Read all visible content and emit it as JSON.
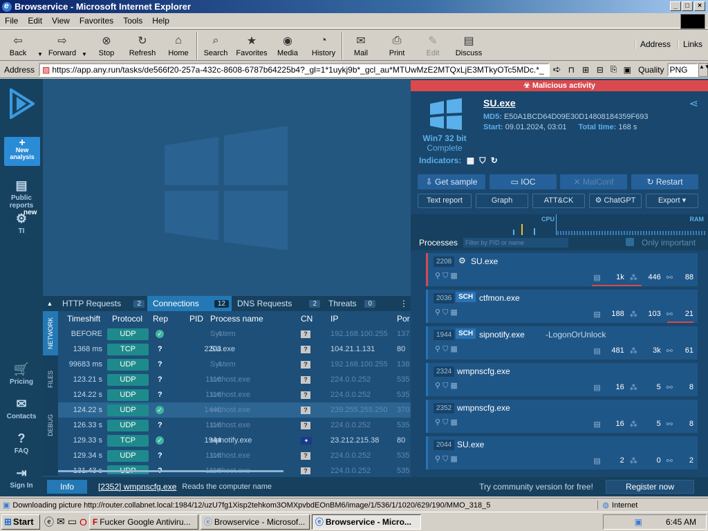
{
  "window": {
    "title": "Browservice - Microsoft Internet Explorer"
  },
  "menu": [
    "File",
    "Edit",
    "View",
    "Favorites",
    "Tools",
    "Help"
  ],
  "toolbar": {
    "back": "Back",
    "forward": "Forward",
    "stop": "Stop",
    "refresh": "Refresh",
    "home": "Home",
    "search": "Search",
    "favorites": "Favorites",
    "media": "Media",
    "history": "History",
    "mail": "Mail",
    "print": "Print",
    "edit": "Edit",
    "discuss": "Discuss",
    "address_label": "Address",
    "links_label": "Links"
  },
  "addressbar": {
    "label": "Address",
    "url": "https://app.any.run/tasks/de566f20-257a-432c-8608-6787b64225b4?_gl=1*1uykj9b*_gcl_au*MTUwMzE2MTQxLjE3MTkyOTc5MDc.*_",
    "quality_label": "Quality",
    "quality_value": "PNG"
  },
  "leftnav": {
    "new_analysis": "New analysis",
    "public_reports": "Public reports",
    "ti_badge": "new",
    "ti": "TI",
    "pricing": "Pricing",
    "contacts": "Contacts",
    "faq": "FAQ",
    "signin": "Sign In"
  },
  "tabs": [
    {
      "label": "HTTP Requests",
      "count": "2"
    },
    {
      "label": "Connections",
      "count": "12"
    },
    {
      "label": "DNS Requests",
      "count": "2"
    },
    {
      "label": "Threats",
      "count": "0"
    }
  ],
  "vtabs": [
    "NETWORK",
    "FILES",
    "DEBUG"
  ],
  "connections": {
    "headers": [
      "Timeshift",
      "Protocol",
      "Rep",
      "PID",
      "Process name",
      "CN",
      "IP",
      "Por"
    ],
    "rows": [
      {
        "time": "BEFORE",
        "proto": "UDP",
        "rep": "ok",
        "pid": "4",
        "proc": "System",
        "ip": "192.168.100.255",
        "port": "137"
      },
      {
        "time": "1368 ms",
        "proto": "TCP",
        "rep": "?",
        "pid": "2208",
        "proc": "SU.exe",
        "ip": "104.21.1.131",
        "port": "80"
      },
      {
        "time": "99683 ms",
        "proto": "UDP",
        "rep": "?",
        "pid": "4",
        "proc": "System",
        "ip": "192.168.100.255",
        "port": "138"
      },
      {
        "time": "123.21 s",
        "proto": "UDP",
        "rep": "?",
        "pid": "1116",
        "proc": "svchost.exe",
        "ip": "224.0.0.252",
        "port": "535"
      },
      {
        "time": "124.22 s",
        "proto": "UDP",
        "rep": "?",
        "pid": "1116",
        "proc": "svchost.exe",
        "ip": "224.0.0.252",
        "port": "535"
      },
      {
        "time": "124.22 s",
        "proto": "UDP",
        "rep": "ok",
        "pid": "1440",
        "proc": "svchost.exe",
        "ip": "239.255.255.250",
        "port": "370"
      },
      {
        "time": "126.33 s",
        "proto": "UDP",
        "rep": "?",
        "pid": "1116",
        "proc": "svchost.exe",
        "ip": "224.0.0.252",
        "port": "535"
      },
      {
        "time": "129.33 s",
        "proto": "TCP",
        "rep": "ok",
        "pid": "1944",
        "proc": "sipnotify.exe",
        "ip": "23.212.215.38",
        "port": "80"
      },
      {
        "time": "129.34 s",
        "proto": "UDP",
        "rep": "?",
        "pid": "1116",
        "proc": "svchost.exe",
        "ip": "224.0.0.252",
        "port": "535"
      },
      {
        "time": "131.43 s",
        "proto": "UDP",
        "rep": "?",
        "pid": "1116",
        "proc": "svchost.exe",
        "ip": "224.0.0.252",
        "port": "535"
      }
    ]
  },
  "infobar": {
    "button": "Info",
    "proc": "[2352] wmpnscfg.exe",
    "text": "Reads the computer name",
    "community": "Try community version for free!",
    "register": "Register now"
  },
  "report": {
    "malicious": "Malicious activity",
    "filename": "SU.exe",
    "md5_label": "MD5:",
    "md5": "E50A1BCD64D09E30D14808184359F693",
    "start_label": "Start:",
    "start": "09.01.2024, 03:01",
    "total_label": "Total time:",
    "total": "168 s",
    "os": "Win7 32 bit",
    "status": "Complete",
    "indicators": "Indicators:",
    "get_sample": "Get sample",
    "ioc": "IOC",
    "malconf": "MalConf",
    "restart": "Restart",
    "text_report": "Text report",
    "graph": "Graph",
    "attck": "ATT&CK",
    "chatgpt": "ChatGPT",
    "export": "Export",
    "cpu": "CPU",
    "ram": "RAM",
    "processes": "Processes",
    "filter_placeholder": "Filter by PID or name",
    "only_important": "Only important"
  },
  "processes": [
    {
      "pid": "2208",
      "name": "SU.exe",
      "sch": "",
      "args": "",
      "s1": "1k",
      "s2": "446",
      "s3": "88",
      "bad": true
    },
    {
      "pid": "2036",
      "name": "ctfmon.exe",
      "sch": "SCH",
      "args": "",
      "s1": "188",
      "s2": "103",
      "s3": "21",
      "bad": false
    },
    {
      "pid": "1944",
      "name": "sipnotify.exe",
      "sch": "SCH",
      "args": "-LogonOrUnlock",
      "s1": "481",
      "s2": "3k",
      "s3": "61",
      "bad": false
    },
    {
      "pid": "2324",
      "name": "wmpnscfg.exe",
      "sch": "",
      "args": "",
      "s1": "16",
      "s2": "5",
      "s3": "8",
      "bad": false
    },
    {
      "pid": "2352",
      "name": "wmpnscfg.exe",
      "sch": "",
      "args": "",
      "s1": "16",
      "s2": "5",
      "s3": "8",
      "bad": false
    },
    {
      "pid": "2044",
      "name": "SU.exe",
      "sch": "",
      "args": "",
      "s1": "2",
      "s2": "0",
      "s3": "2",
      "bad": false
    }
  ],
  "statusbar": {
    "text": "Downloading picture http://router.collabnet.local:1984/12/uzU7fg1Xisp2tehkom3OMXpvbdEOnBM6/image/1/536/1/1020/629/190/MMO_318_5",
    "zone": "Internet"
  },
  "taskbar": {
    "start": "Start",
    "tasks": [
      "Fucker Google Antiviru...",
      "Browservice - Microsof...",
      "Browservice - Micro..."
    ],
    "clock": "6:45 AM"
  }
}
